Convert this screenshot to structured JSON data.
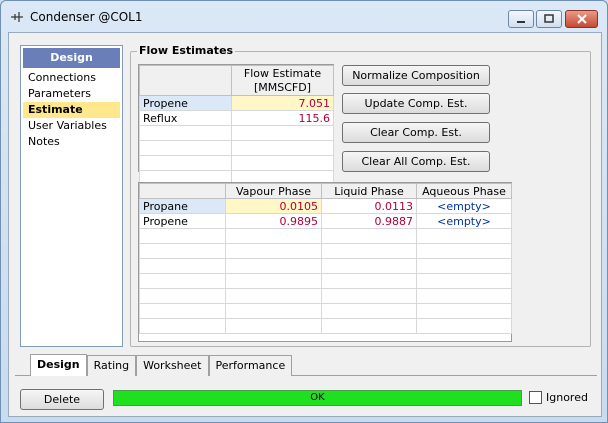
{
  "window": {
    "title": "Condenser @COL1",
    "icon": "condenser-icon"
  },
  "nav": {
    "header": "Design",
    "items": [
      {
        "label": "Connections",
        "active": false
      },
      {
        "label": "Parameters",
        "active": false
      },
      {
        "label": "Estimate",
        "active": true
      },
      {
        "label": "User Variables",
        "active": false
      },
      {
        "label": "Notes",
        "active": false
      }
    ]
  },
  "flow_estimates": {
    "group_title": "Flow Estimates",
    "column_header_line1": "Flow Estimate",
    "column_header_line2": "[MMSCFD]",
    "rows": [
      {
        "label": "Propene",
        "value": "7.051"
      },
      {
        "label": "Reflux",
        "value": "115.6"
      }
    ]
  },
  "buttons": {
    "normalize": "Normalize Composition",
    "update": "Update Comp. Est.",
    "clear": "Clear Comp. Est.",
    "clear_all": "Clear All Comp. Est.",
    "delete": "Delete"
  },
  "phase_table": {
    "headers": [
      "Vapour Phase",
      "Liquid Phase",
      "Aqueous Phase"
    ],
    "rows": [
      {
        "label": "Propane",
        "vapour": "0.0105",
        "liquid": "0.0113",
        "aqueous": "<empty>"
      },
      {
        "label": "Propene",
        "vapour": "0.9895",
        "liquid": "0.9887",
        "aqueous": "<empty>"
      }
    ]
  },
  "tabs": [
    {
      "label": "Design",
      "active": true
    },
    {
      "label": "Rating",
      "active": false
    },
    {
      "label": "Worksheet",
      "active": false
    },
    {
      "label": "Performance",
      "active": false
    }
  ],
  "status": {
    "text": "OK",
    "color": "#1ee01e"
  },
  "ignored": {
    "label": "Ignored",
    "checked": false
  }
}
